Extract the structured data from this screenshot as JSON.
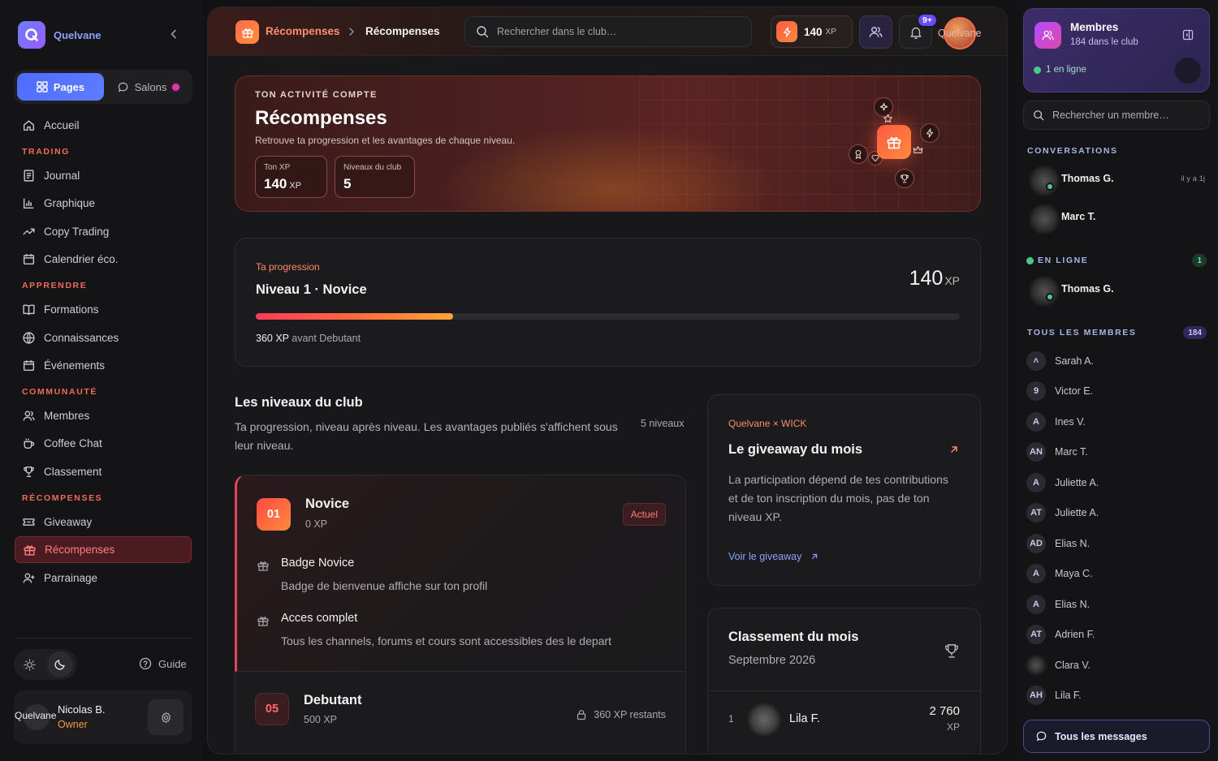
{
  "brand": {
    "name": "Quelvane"
  },
  "sidebar": {
    "segment": {
      "pages": "Pages",
      "salons": "Salons"
    },
    "items": [
      {
        "type": "item",
        "label": "Accueil",
        "icon": "home-icon"
      },
      {
        "type": "section",
        "label": "TRADING"
      },
      {
        "type": "item",
        "label": "Journal",
        "icon": "journal-icon"
      },
      {
        "type": "item",
        "label": "Graphique",
        "icon": "chart-icon"
      },
      {
        "type": "item",
        "label": "Copy Trading",
        "icon": "trend-icon"
      },
      {
        "type": "item",
        "label": "Calendrier éco.",
        "icon": "calendar-icon"
      },
      {
        "type": "section",
        "label": "APPRENDRE"
      },
      {
        "type": "item",
        "label": "Formations",
        "icon": "book-icon"
      },
      {
        "type": "item",
        "label": "Connaissances",
        "icon": "globe-icon"
      },
      {
        "type": "item",
        "label": "Événements",
        "icon": "calendar-icon"
      },
      {
        "type": "section",
        "label": "COMMUNAUTÉ"
      },
      {
        "type": "item",
        "label": "Membres",
        "icon": "users-icon"
      },
      {
        "type": "item",
        "label": "Coffee Chat",
        "icon": "coffee-icon"
      },
      {
        "type": "item",
        "label": "Classement",
        "icon": "trophy-icon"
      },
      {
        "type": "section",
        "label": "RÉCOMPENSES"
      },
      {
        "type": "item",
        "label": "Giveaway",
        "icon": "ticket-icon"
      },
      {
        "type": "item",
        "label": "Récompenses",
        "icon": "gift-icon",
        "active": true
      },
      {
        "type": "item",
        "label": "Parrainage",
        "icon": "user-plus-icon"
      }
    ],
    "guide": "Guide",
    "user": {
      "avatar_alt": "Quelvane",
      "name": "Nicolas B.",
      "role": "Owner"
    }
  },
  "topbar": {
    "breadcrumb": [
      "Récompenses",
      "Récompenses"
    ],
    "search_placeholder": "Rechercher dans le club…",
    "xp_value": "140",
    "xp_unit": "XP",
    "notif_badge": "9+",
    "avatar_alt": "Quelvane"
  },
  "hero": {
    "kicker": "TON ACTIVITÉ COMPTE",
    "title": "Récompenses",
    "subtitle": "Retrouve ta progression et les avantages de chaque niveau.",
    "stats": [
      {
        "label": "Ton XP",
        "value": "140",
        "unit": "XP"
      },
      {
        "label": "Niveaux du club",
        "value": "5",
        "unit": ""
      }
    ]
  },
  "progression": {
    "label": "Ta progression",
    "level": "Niveau 1 · Novice",
    "xp": "140",
    "xp_unit": "XP",
    "progress_fraction": 0.28,
    "remaining_value": "360 XP",
    "remaining_text": " avant Debutant"
  },
  "levels": {
    "title": "Les niveaux du club",
    "description": "Ta progression, niveau après niveau. Les avantages publiés s'affichent sous leur niveau.",
    "count": "5 niveaux",
    "current": {
      "number": "01",
      "name": "Novice",
      "xp": "0 XP",
      "badge": "Actuel",
      "perks": [
        {
          "title": "Badge Novice",
          "desc": "Badge de bienvenue affiche sur ton profil"
        },
        {
          "title": "Acces complet",
          "desc": "Tous les channels, forums et cours sont accessibles des le depart"
        }
      ]
    },
    "next": {
      "number": "05",
      "name": "Debutant",
      "xp": "500 XP",
      "remaining": "360 XP restants"
    }
  },
  "giveaway": {
    "kicker": "Quelvane × WICK",
    "title": "Le giveaway du mois",
    "description": "La participation dépend de tes contributions et de ton inscription du mois, pas de ton niveau XP.",
    "link": "Voir le giveaway"
  },
  "ranking": {
    "title": "Classement du mois",
    "subtitle": "Septembre 2026",
    "rows": [
      {
        "rank": "1",
        "name": "Lila F.",
        "points": "2 760",
        "unit": "XP"
      }
    ]
  },
  "members_panel": {
    "title": "Membres",
    "subtitle": "184 dans le club",
    "online_text": "1 en ligne",
    "search_placeholder": "Rechercher un membre…",
    "conversations_label": "CONVERSATIONS",
    "conversations": [
      {
        "name": "Thomas G.",
        "time": "il y a 1j",
        "online": true
      },
      {
        "name": "Marc T.",
        "time": "",
        "online": false
      }
    ],
    "online_label": "EN LIGNE",
    "online_count": "1",
    "online_members": [
      {
        "name": "Thomas G."
      }
    ],
    "all_label": "TOUS LES MEMBRES",
    "all_count": "184",
    "members": [
      {
        "initials": "˄",
        "name": "Sarah A."
      },
      {
        "initials": "9",
        "name": "Victor E."
      },
      {
        "initials": "A",
        "name": "Ines V."
      },
      {
        "initials": "AN",
        "name": "Marc T."
      },
      {
        "initials": "A",
        "name": "Juliette A."
      },
      {
        "initials": "AT",
        "name": "Juliette A."
      },
      {
        "initials": "AD",
        "name": "Elias N."
      },
      {
        "initials": "A",
        "name": "Maya C."
      },
      {
        "initials": "A",
        "name": "Elias N."
      },
      {
        "initials": "AT",
        "name": "Adrien F."
      },
      {
        "initials": "",
        "name": "Clara V."
      },
      {
        "initials": "AH",
        "name": "Lila F."
      }
    ],
    "all_messages": "Tous les messages"
  },
  "colors": {
    "accent": "#ff6a4a",
    "brand": "#6a7dff",
    "active_nav": "#ff7d7d",
    "online": "#4ac98a"
  }
}
